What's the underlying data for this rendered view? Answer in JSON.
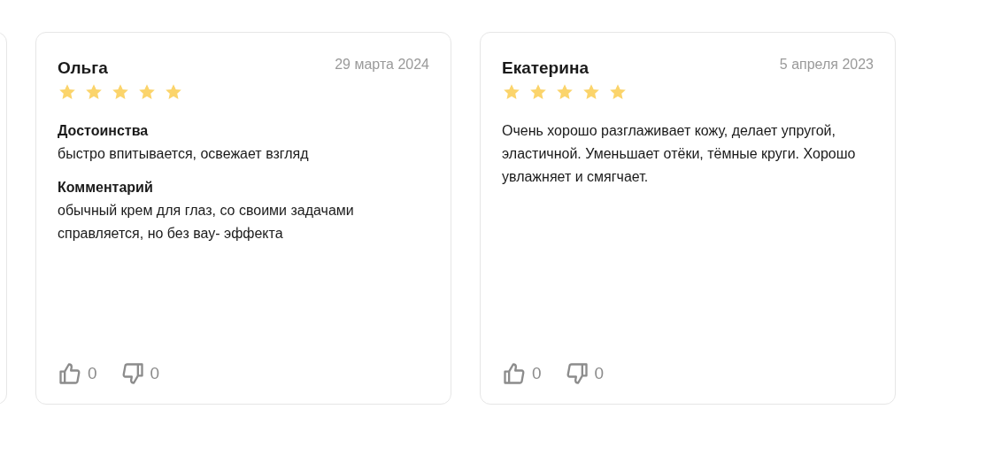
{
  "reviews": [
    {
      "kind": "sections",
      "author": "Ольга",
      "date": "29 марта 2024",
      "stars": 5,
      "sections": [
        {
          "heading": "Достоинства",
          "text": "быстро впитывается, освежает взгляд"
        },
        {
          "heading": "Комментарий",
          "text": "обычный крем для глаз, со своими задачами справляется, но без вау- эффекта"
        }
      ],
      "likes": "0",
      "dislikes": "0"
    },
    {
      "kind": "text",
      "author": "Екатерина",
      "date": "5 апреля 2023",
      "stars": 5,
      "text": "Очень хорошо разглаживает кожу, делает упругой, эластичной. Уменьшает отёки, тёмные круги. Хорошо увлажняет и смягчает.",
      "likes": "0",
      "dislikes": "0"
    }
  ]
}
